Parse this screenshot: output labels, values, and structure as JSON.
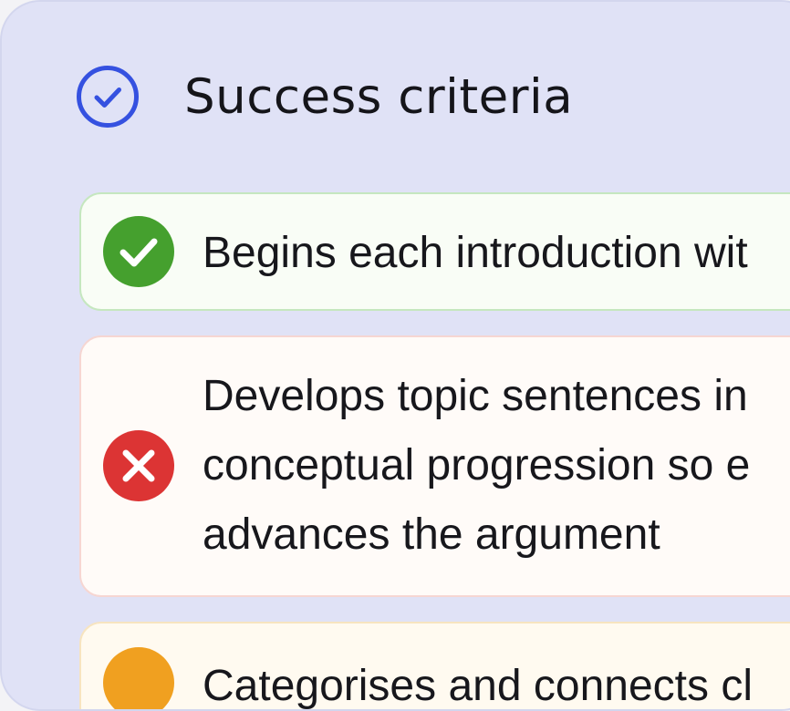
{
  "header": {
    "title": "Success criteria",
    "icon": "check-circle-outline-icon",
    "accent_color": "#3551e0"
  },
  "criteria": [
    {
      "status": "met",
      "icon": "check-circle-icon",
      "color": "#45a02e",
      "text": "Begins each introduction wit"
    },
    {
      "status": "unmet",
      "icon": "x-circle-icon",
      "color": "#dc3434",
      "lines": [
        "Develops topic sentences in",
        "conceptual progression so e",
        "advances the argument"
      ]
    },
    {
      "status": "partial",
      "color": "#f0a020",
      "text": "Categorises and connects cl"
    }
  ]
}
